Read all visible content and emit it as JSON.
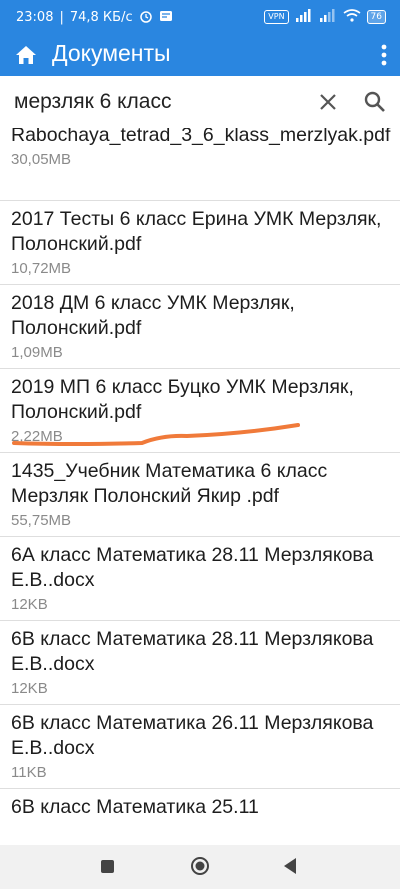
{
  "status_bar": {
    "time": "23:08",
    "speed": "74,8 КБ/с",
    "vpn": "VPN",
    "battery": "76"
  },
  "app_bar": {
    "title": "Документы",
    "icons": [
      "home-icon",
      "more-vert-icon"
    ]
  },
  "search": {
    "query": "мерзляк 6 класс",
    "icons": [
      "clear-icon",
      "search-icon"
    ]
  },
  "files": [
    {
      "name": "Rabochaya_tetrad_3_6_klass_merzlyak.pdf",
      "size": "30,05MB"
    },
    {
      "name": "2017 Тесты 6 класс Ерина УМК Мерзляк, Полонский.pdf",
      "size": "10,72MB"
    },
    {
      "name": "2018 ДМ 6 класс УМК Мерзляк, Полонский.pdf",
      "size": "1,09MB"
    },
    {
      "name": "2019 МП 6 класс Буцко УМК Мерзляк, Полонский.pdf",
      "size": "2,22MB"
    },
    {
      "name": "1435_Учебник Математика 6 класс Мерзляк Полонский Якир .pdf",
      "size": "55,75MB"
    },
    {
      "name": "6А класс  Математика 28.11 Мерзлякова Е.В..docx",
      "size": "12KB"
    },
    {
      "name": "6В класс  Математика 28.11 Мерзлякова Е.В..docx",
      "size": "12KB"
    },
    {
      "name": "6В класс  Математика 26.11 Мерзлякова Е.В..docx",
      "size": "11KB"
    },
    {
      "name": "6В класс  Математика 25.11",
      "size": ""
    }
  ],
  "colors": {
    "accent": "#2a86e0",
    "annotation": "#f07a3a"
  },
  "nav_bar": {
    "icons": [
      "recents-icon",
      "home-circle-icon",
      "back-icon"
    ]
  }
}
